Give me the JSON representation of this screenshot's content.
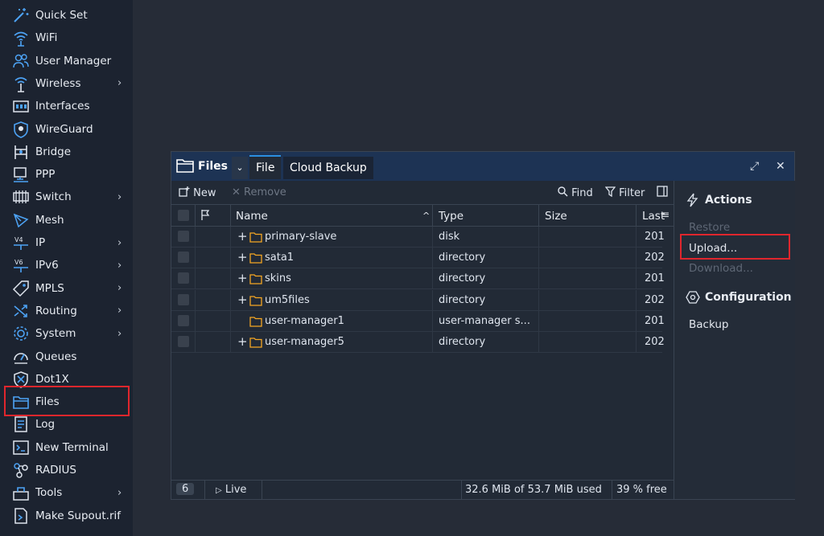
{
  "sidebar": {
    "items": [
      {
        "label": "Quick Set",
        "icon": "wand-icon",
        "chevron": false
      },
      {
        "label": "WiFi",
        "icon": "wifi-icon",
        "chevron": false
      },
      {
        "label": "User Manager",
        "icon": "users-icon",
        "chevron": false
      },
      {
        "label": "Wireless",
        "icon": "wireless-icon",
        "chevron": true
      },
      {
        "label": "Interfaces",
        "icon": "interfaces-icon",
        "chevron": false
      },
      {
        "label": "WireGuard",
        "icon": "wireguard-icon",
        "chevron": false
      },
      {
        "label": "Bridge",
        "icon": "bridge-icon",
        "chevron": false
      },
      {
        "label": "PPP",
        "icon": "ppp-icon",
        "chevron": false
      },
      {
        "label": "Switch",
        "icon": "switch-icon",
        "chevron": true
      },
      {
        "label": "Mesh",
        "icon": "mesh-icon",
        "chevron": false
      },
      {
        "label": "IP",
        "icon": "ip-icon",
        "chevron": true
      },
      {
        "label": "IPv6",
        "icon": "ipv6-icon",
        "chevron": true
      },
      {
        "label": "MPLS",
        "icon": "mpls-icon",
        "chevron": true
      },
      {
        "label": "Routing",
        "icon": "routing-icon",
        "chevron": true
      },
      {
        "label": "System",
        "icon": "gear-icon",
        "chevron": true
      },
      {
        "label": "Queues",
        "icon": "queues-icon",
        "chevron": false
      },
      {
        "label": "Dot1X",
        "icon": "dot1x-icon",
        "chevron": false
      },
      {
        "label": "Files",
        "icon": "folder-icon",
        "chevron": false
      },
      {
        "label": "Log",
        "icon": "log-icon",
        "chevron": false
      },
      {
        "label": "New Terminal",
        "icon": "terminal-icon",
        "chevron": false
      },
      {
        "label": "RADIUS",
        "icon": "radius-icon",
        "chevron": false
      },
      {
        "label": "Tools",
        "icon": "tools-icon",
        "chevron": true
      },
      {
        "label": "Make Supout.rif",
        "icon": "supout-icon",
        "chevron": false
      }
    ],
    "chevron": "›"
  },
  "window": {
    "title": "Files",
    "dropdown": "⌄",
    "tabs": [
      "File",
      "Cloud Backup"
    ],
    "maximize": "⤢",
    "close": "✕"
  },
  "toolbar": {
    "new": "New",
    "remove": "Remove",
    "find": "Find",
    "filter": "Filter"
  },
  "table": {
    "columns": {
      "name": "Name",
      "type": "Type",
      "size": "Size",
      "last": "Last"
    },
    "rows": [
      {
        "name": "primary-slave",
        "type": "disk",
        "size": "",
        "last": "201",
        "expand": true
      },
      {
        "name": "sata1",
        "type": "directory",
        "size": "",
        "last": "202",
        "expand": true
      },
      {
        "name": "skins",
        "type": "directory",
        "size": "",
        "last": "201",
        "expand": true
      },
      {
        "name": "um5files",
        "type": "directory",
        "size": "",
        "last": "202",
        "expand": true
      },
      {
        "name": "user-manager1",
        "type": "user-manager s...",
        "size": "",
        "last": "201",
        "expand": false
      },
      {
        "name": "user-manager5",
        "type": "directory",
        "size": "",
        "last": "202",
        "expand": true
      }
    ]
  },
  "status": {
    "count": "6",
    "live": "Live",
    "usage": "32.6 MiB of 53.7 MiB  used",
    "free": "39 % free"
  },
  "actions": {
    "heading": "Actions",
    "restore": "Restore",
    "upload": "Upload...",
    "download": "Download...",
    "config_heading": "Configuration",
    "backup": "Backup"
  },
  "colors": {
    "accent": "#2b8fe0",
    "folder": "#f5a623",
    "highlight": "#e0262d",
    "titlebar": "#1d3354"
  }
}
